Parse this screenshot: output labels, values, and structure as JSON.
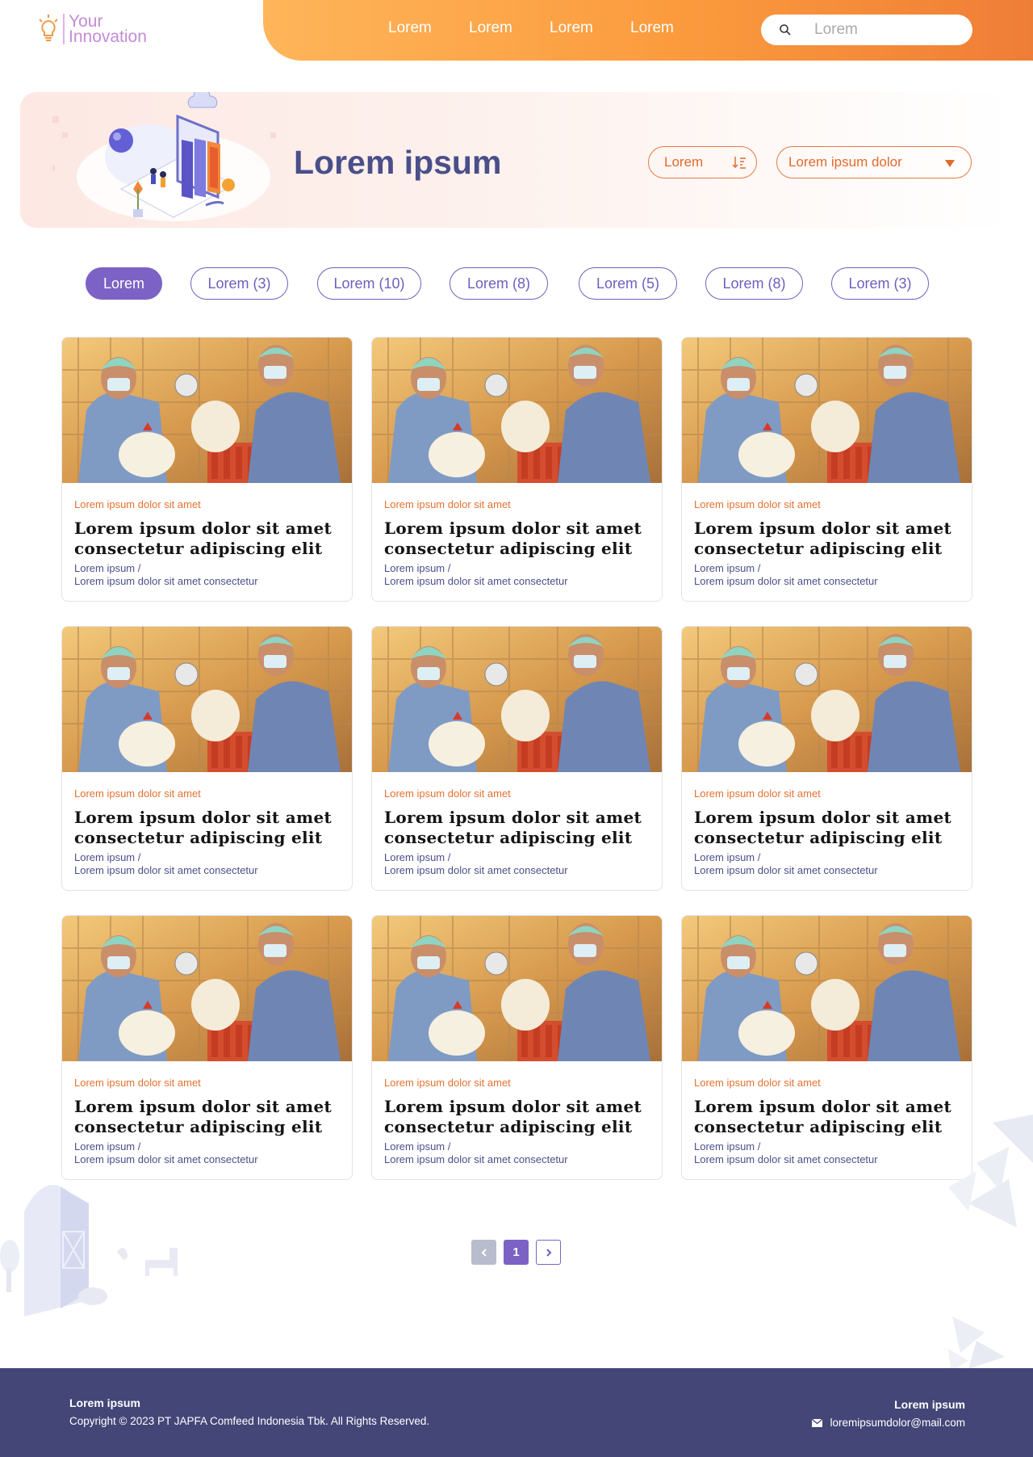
{
  "brand": {
    "line1": "Your",
    "line2": "Innovation"
  },
  "nav": {
    "items": [
      {
        "label": "Lorem"
      },
      {
        "label": "Lorem"
      },
      {
        "label": "Lorem"
      },
      {
        "label": "Lorem"
      }
    ],
    "search_placeholder": "Lorem"
  },
  "hero": {
    "title": "Lorem ipsum",
    "sort_label": "Lorem",
    "select_value": "Lorem ipsum dolor"
  },
  "filters": [
    {
      "label": "Lorem",
      "active": true
    },
    {
      "label": "Lorem (3)",
      "active": false
    },
    {
      "label": "Lorem (10)",
      "active": false
    },
    {
      "label": "Lorem (8)",
      "active": false
    },
    {
      "label": "Lorem (5)",
      "active": false
    },
    {
      "label": "Lorem (8)",
      "active": false
    },
    {
      "label": "Lorem (3)",
      "active": false
    }
  ],
  "cards": [
    {
      "category": "Lorem ipsum dolor sit amet",
      "title_line1": "Lorem ipsum dolor sit amet",
      "title_line2": "consectetur adipiscing elit",
      "meta_line1": "Lorem ipsum /",
      "meta_line2": "Lorem ipsum dolor sit amet consectetur"
    },
    {
      "category": "Lorem ipsum dolor sit amet",
      "title_line1": "Lorem ipsum dolor sit amet",
      "title_line2": "consectetur adipiscing elit",
      "meta_line1": "Lorem ipsum /",
      "meta_line2": "Lorem ipsum dolor sit amet consectetur"
    },
    {
      "category": "Lorem ipsum dolor sit amet",
      "title_line1": "Lorem ipsum dolor sit amet",
      "title_line2": "consectetur adipiscing elit",
      "meta_line1": "Lorem ipsum /",
      "meta_line2": "Lorem ipsum dolor sit amet consectetur"
    },
    {
      "category": "Lorem ipsum dolor sit amet",
      "title_line1": "Lorem ipsum dolor sit amet",
      "title_line2": "consectetur adipiscing elit",
      "meta_line1": "Lorem ipsum /",
      "meta_line2": "Lorem ipsum dolor sit amet consectetur"
    },
    {
      "category": "Lorem ipsum dolor sit amet",
      "title_line1": "Lorem ipsum dolor sit amet",
      "title_line2": "consectetur adipiscing elit",
      "meta_line1": "Lorem ipsum /",
      "meta_line2": "Lorem ipsum dolor sit amet consectetur"
    },
    {
      "category": "Lorem ipsum dolor sit amet",
      "title_line1": "Lorem ipsum dolor sit amet",
      "title_line2": "consectetur adipiscing elit",
      "meta_line1": "Lorem ipsum /",
      "meta_line2": "Lorem ipsum dolor sit amet consectetur"
    },
    {
      "category": "Lorem ipsum dolor sit amet",
      "title_line1": "Lorem ipsum dolor sit amet",
      "title_line2": "consectetur adipiscing elit",
      "meta_line1": "Lorem ipsum /",
      "meta_line2": "Lorem ipsum dolor sit amet consectetur"
    },
    {
      "category": "Lorem ipsum dolor sit amet",
      "title_line1": "Lorem ipsum dolor sit amet",
      "title_line2": "consectetur adipiscing elit",
      "meta_line1": "Lorem ipsum /",
      "meta_line2": "Lorem ipsum dolor sit amet consectetur"
    },
    {
      "category": "Lorem ipsum dolor sit amet",
      "title_line1": "Lorem ipsum dolor sit amet",
      "title_line2": "consectetur adipiscing elit",
      "meta_line1": "Lorem ipsum /",
      "meta_line2": "Lorem ipsum dolor sit amet consectetur"
    }
  ],
  "pagination": {
    "current": "1"
  },
  "footer": {
    "left_title": "Lorem ipsum",
    "copyright": "Copyright © 2023 PT JAPFA Comfeed Indonesia Tbk. All Rights Reserved.",
    "right_title": "Lorem ipsum",
    "email": "loremipsumdolor@mail.com"
  },
  "colors": {
    "accent_purple": "#7c62c4",
    "accent_orange": "#e5712f",
    "navy": "#434677"
  },
  "icons": [
    "lightbulb-icon",
    "search-icon",
    "sort-icon",
    "chevron-down-icon",
    "chevron-left-icon",
    "chevron-right-icon",
    "mail-icon"
  ]
}
